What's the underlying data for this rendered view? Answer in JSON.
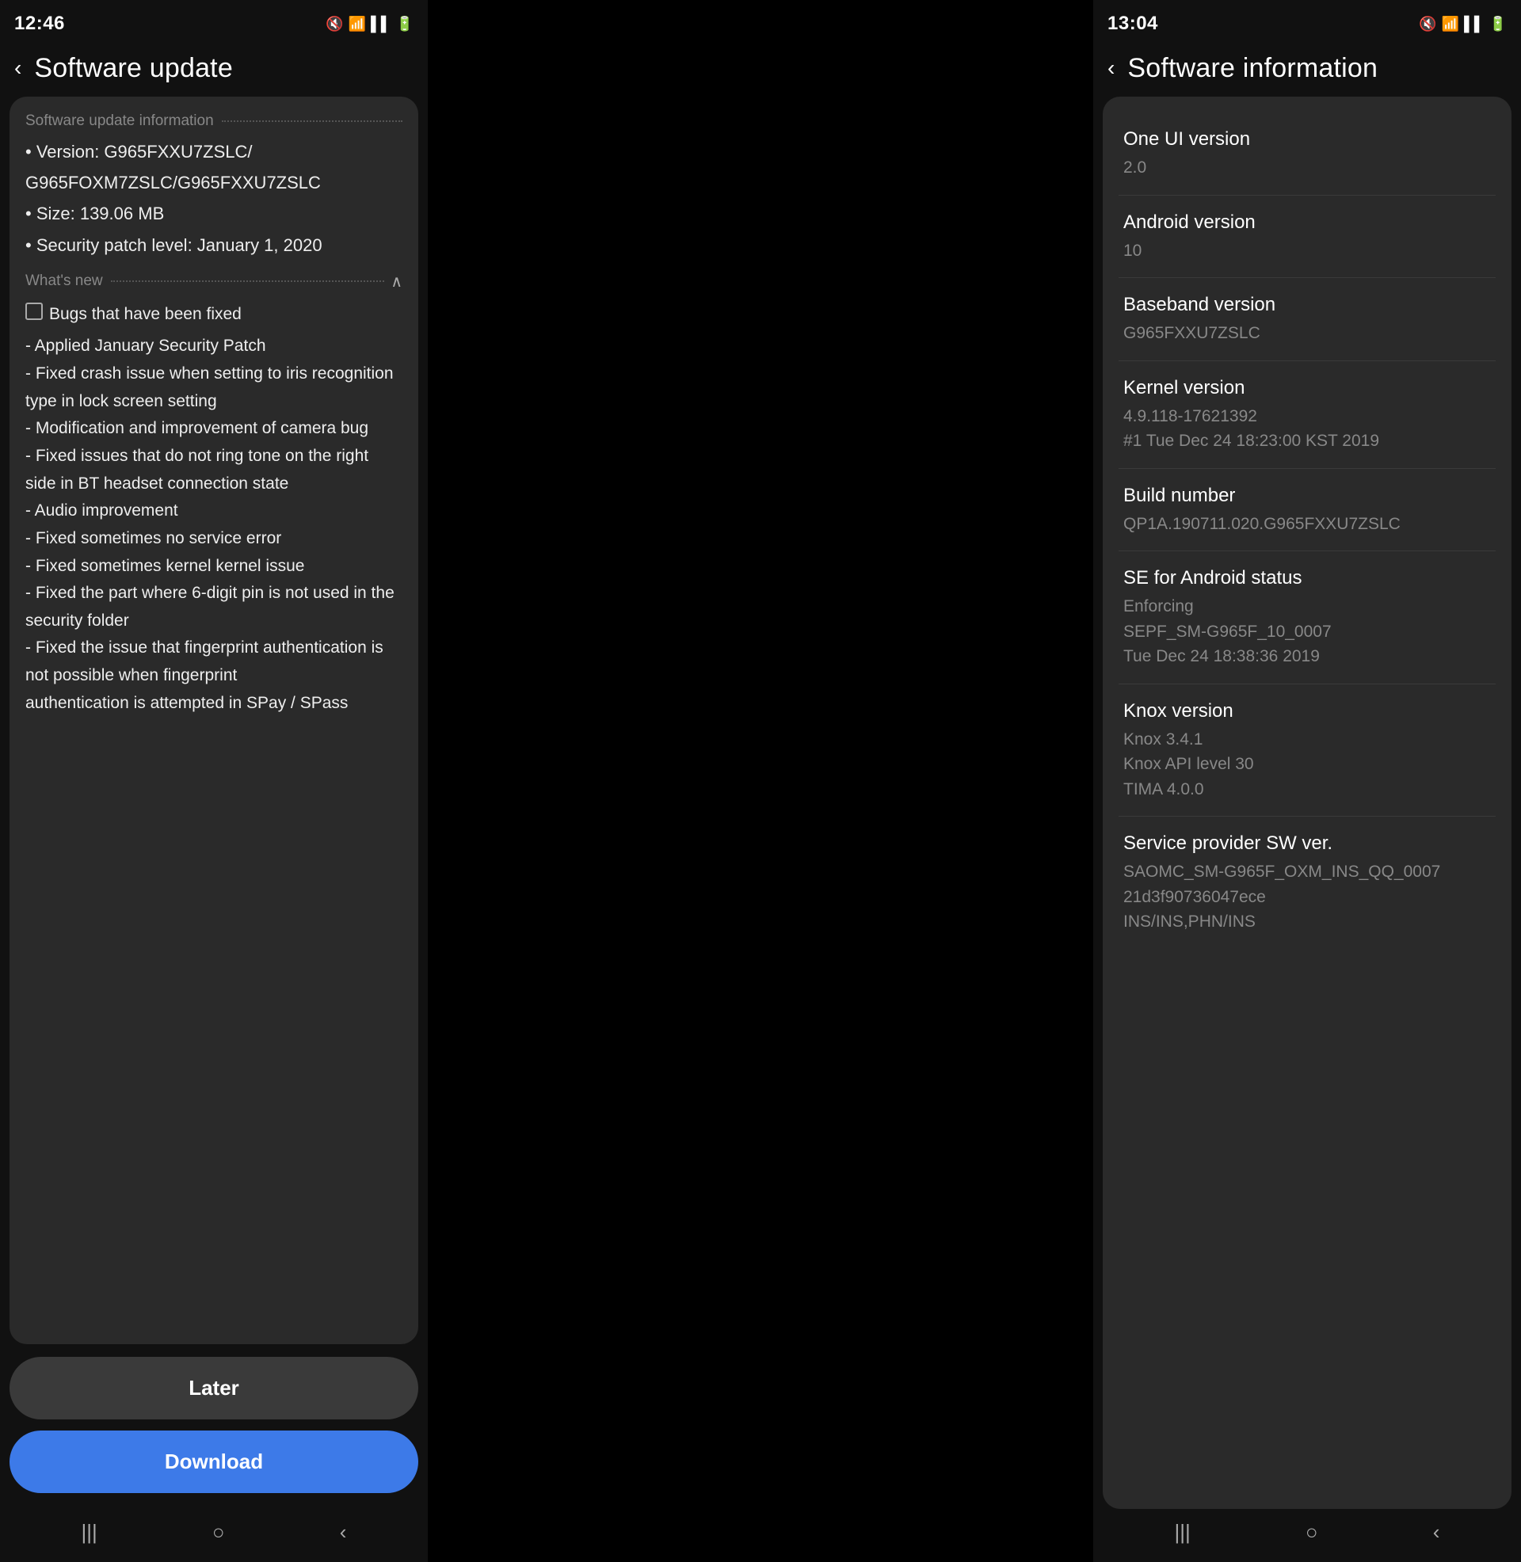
{
  "left_phone": {
    "status_bar": {
      "time": "12:46",
      "icons": [
        "silent",
        "wifi",
        "signal",
        "battery"
      ]
    },
    "header": {
      "back_label": "‹",
      "title": "Software update"
    },
    "update_info_section": {
      "section_title": "Software update information",
      "version_label": "• Version: G965FXXU7ZSLC/",
      "version_line2": "  G965FOXM7ZSLC/G965FXXU7ZSLC",
      "size_label": "• Size: 139.06 MB",
      "security_patch_label": "• Security patch level: January 1, 2020"
    },
    "whats_new_section": {
      "title": "What's new",
      "items": [
        "Bugs that have been fixed",
        "- Applied January Security Patch",
        "- Fixed crash issue when setting to iris recognition type in lock screen setting",
        "- Modification and improvement of camera bug",
        "- Fixed issues that do not ring tone on the right side in BT headset connection state",
        "- Audio improvement",
        "- Fixed sometimes no service error",
        "- Fixed sometimes kernel kernel issue",
        "- Fixed the part where 6-digit pin is not used in the security folder",
        "- Fixed the issue that fingerprint authentication is not possible when fingerprint authentication is attempted in SPay / SPass"
      ]
    },
    "buttons": {
      "later_label": "Later",
      "download_label": "Download"
    },
    "nav": {
      "recents": "|||",
      "home": "○",
      "back": "‹"
    }
  },
  "right_phone": {
    "status_bar": {
      "time": "13:04",
      "icons": [
        "silent",
        "wifi",
        "signal",
        "battery"
      ]
    },
    "header": {
      "back_label": "‹",
      "title": "Software information"
    },
    "info_items": [
      {
        "label": "One UI version",
        "value": "2.0"
      },
      {
        "label": "Android version",
        "value": "10"
      },
      {
        "label": "Baseband version",
        "value": "G965FXXU7ZSLC"
      },
      {
        "label": "Kernel version",
        "value": "4.9.118-17621392\n#1 Tue Dec 24 18:23:00 KST 2019"
      },
      {
        "label": "Build number",
        "value": "QP1A.190711.020.G965FXXU7ZSLC"
      },
      {
        "label": "SE for Android status",
        "value": "Enforcing\nSEPF_SM-G965F_10_0007\nTue Dec 24 18:38:36 2019"
      },
      {
        "label": "Knox version",
        "value": "Knox 3.4.1\nKnox API level 30\nTIMA 4.0.0"
      },
      {
        "label": "Service provider SW ver.",
        "value": "SAOMC_SM-G965F_OXM_INS_QQ_0007\n21d3f90736047ece\nINS/INS,PHN/INS"
      }
    ],
    "nav": {
      "recents": "|||",
      "home": "○",
      "back": "‹"
    }
  }
}
